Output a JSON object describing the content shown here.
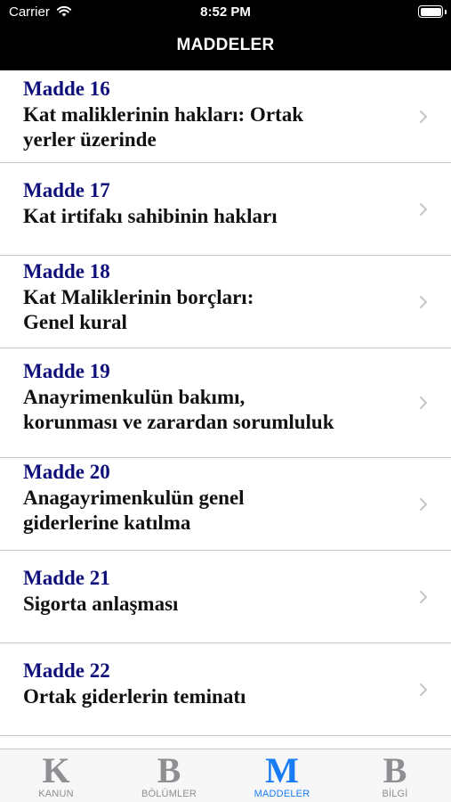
{
  "status_bar": {
    "carrier": "Carrier",
    "time": "8:52 PM",
    "icons": [
      "wifi-icon",
      "battery-icon"
    ]
  },
  "nav": {
    "title": "MADDELER"
  },
  "items": [
    {
      "title": "Madde 16",
      "lines": [
        "Kat maliklerinin hakları: Ortak",
        "yerler üzerinde"
      ]
    },
    {
      "title": "Madde 17",
      "lines": [
        "Kat irtifakı sahibinin hakları"
      ]
    },
    {
      "title": "Madde 18",
      "lines": [
        "Kat Maliklerinin borçları:",
        "Genel kural"
      ]
    },
    {
      "title": "Madde 19",
      "lines": [
        "Anayrimenkulün bakımı,",
        "korunması ve zarardan sorumluluk"
      ]
    },
    {
      "title": "Madde 20",
      "lines": [
        "Anagayrimenkulün genel",
        "giderlerine katılma"
      ]
    },
    {
      "title": "Madde 21",
      "lines": [
        "Sigorta anlaşması"
      ]
    },
    {
      "title": "Madde 22",
      "lines": [
        "Ortak giderlerin teminatı"
      ]
    }
  ],
  "tabs": [
    {
      "glyph": "K",
      "label": "KANUN",
      "active": false
    },
    {
      "glyph": "B",
      "label": "BÖLÜMLER",
      "active": false
    },
    {
      "glyph": "M",
      "label": "MADDELER",
      "active": true
    },
    {
      "glyph": "B",
      "label": "BİLGİ",
      "active": false
    }
  ],
  "colors": {
    "nav_background": "#000000",
    "item_title": "#0d0e7a",
    "tab_active": "#1a7cf5",
    "tab_inactive": "#8e8e93"
  }
}
